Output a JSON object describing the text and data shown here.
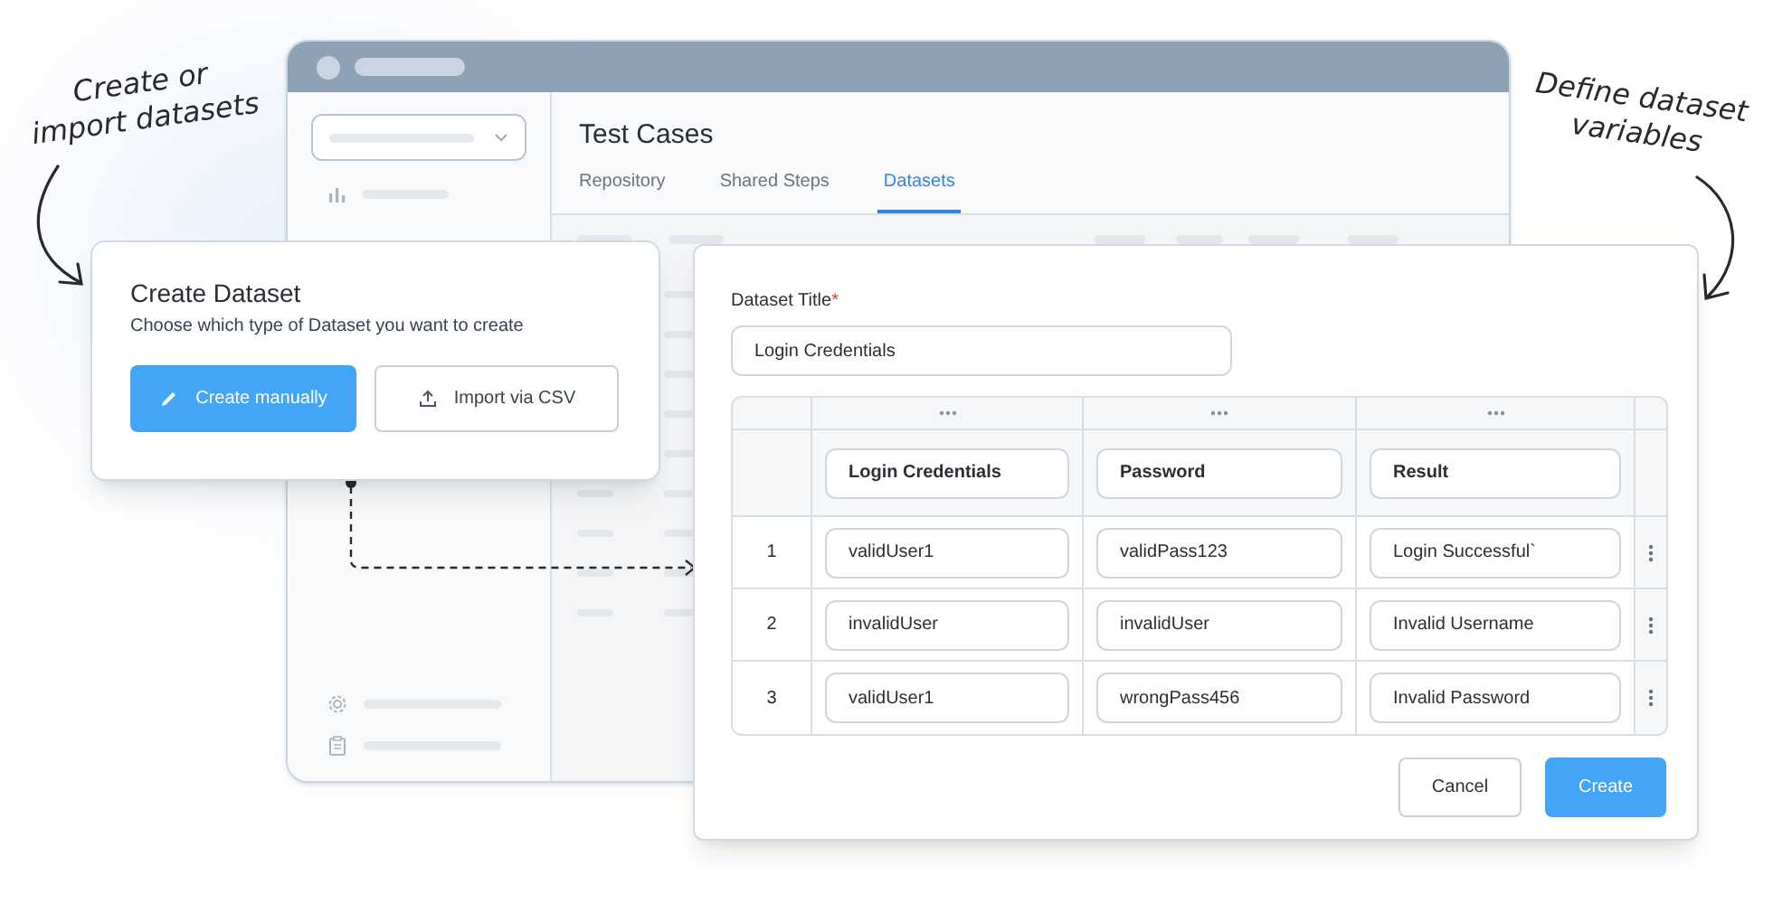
{
  "annotations": [
    {
      "lines": [
        "Create or",
        "import datasets"
      ]
    },
    {
      "lines": [
        "Define dataset",
        "variables"
      ]
    }
  ],
  "app_window": {
    "page_title": "Test Cases",
    "tabs": [
      {
        "label": "Repository",
        "selected": false
      },
      {
        "label": "Shared Steps",
        "selected": false
      },
      {
        "label": "Datasets",
        "selected": true
      }
    ]
  },
  "create_dialog": {
    "title": "Create Dataset",
    "subtitle": "Choose which type of Dataset you want to create",
    "buttons": [
      {
        "label": "Create manually",
        "kind": "primary"
      },
      {
        "label": "Import via CSV",
        "kind": "secondary"
      }
    ]
  },
  "dataset_form": {
    "title_label": "Dataset Title",
    "required_mark": "*",
    "title_value": "Login Credentials",
    "table": {
      "columns": [
        "Login Credentials",
        "Password",
        "Result"
      ],
      "rows": [
        {
          "index": "1",
          "cells": [
            "validUser1",
            "validPass123",
            "Login Successful`"
          ]
        },
        {
          "index": "2",
          "cells": [
            "invalidUser",
            "invalidUser",
            "Invalid Username"
          ]
        },
        {
          "index": "3",
          "cells": [
            "validUser1",
            "wrongPass456",
            "Invalid Password"
          ]
        }
      ]
    },
    "buttons": [
      {
        "label": "Cancel",
        "kind": "secondary"
      },
      {
        "label": "Create",
        "kind": "primary"
      }
    ]
  }
}
